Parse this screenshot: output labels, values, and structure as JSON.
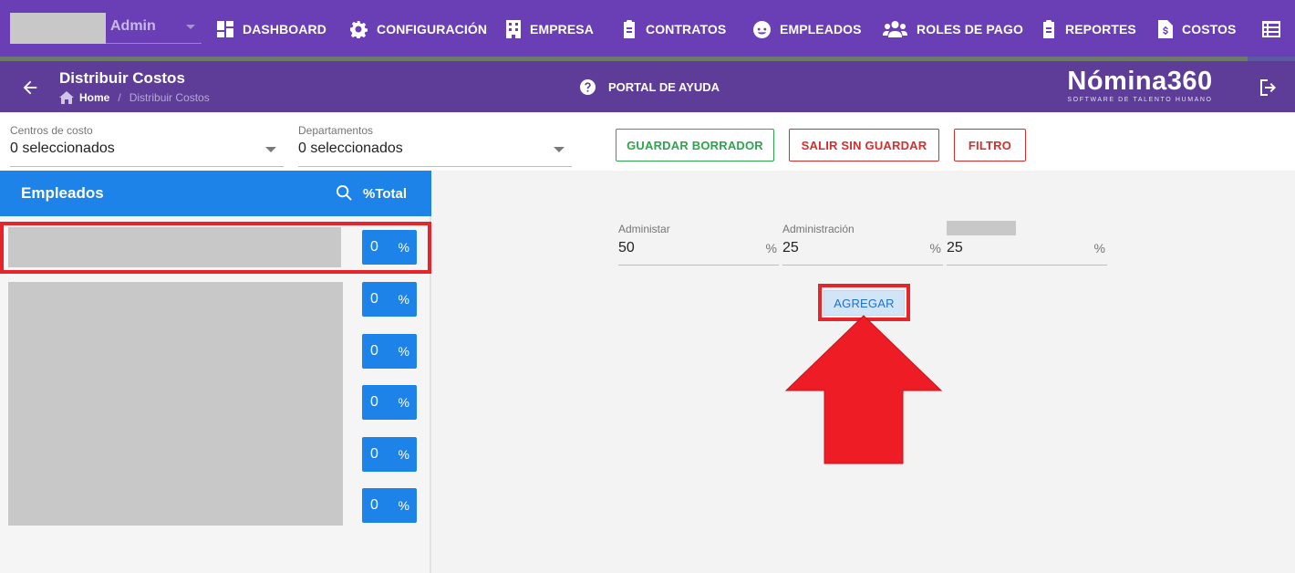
{
  "user": {
    "role": "Admin"
  },
  "nav": [
    {
      "label": "DASHBOARD",
      "icon": "dashboard-icon"
    },
    {
      "label": "CONFIGURACIÓN",
      "icon": "gear-icon"
    },
    {
      "label": "EMPRESA",
      "icon": "building-icon"
    },
    {
      "label": "CONTRATOS",
      "icon": "clipboard-icon"
    },
    {
      "label": "EMPLEADOS",
      "icon": "face-icon"
    },
    {
      "label": "ROLES DE PAGO",
      "icon": "people-icon"
    },
    {
      "label": "REPORTES",
      "icon": "clipboard-icon"
    },
    {
      "label": "COSTOS",
      "icon": "invoice-icon"
    },
    {
      "label": "",
      "icon": "list-icon"
    }
  ],
  "header": {
    "title": "Distribuir Costos",
    "breadcrumb_home": "Home",
    "breadcrumb_sep": "/",
    "breadcrumb_current": "Distribuir Costos",
    "help": "PORTAL DE AYUDA",
    "logo_brand": "Nómina360",
    "logo_tagline": "SOFTWARE DE TALENTO HUMANO"
  },
  "filters": {
    "centros": {
      "label": "Centros de costo",
      "value": "0 seleccionados"
    },
    "departamentos": {
      "label": "Departamentos",
      "value": "0 seleccionados"
    }
  },
  "actions": {
    "guardar": "GUARDAR BORRADOR",
    "salir": "SALIR SIN GUARDAR",
    "filtro": "FILTRO"
  },
  "employees_panel": {
    "title": "Empleados",
    "total_label": "%Total",
    "rows": [
      {
        "value": "0",
        "unit": "%"
      },
      {
        "value": "0",
        "unit": "%"
      },
      {
        "value": "0",
        "unit": "%"
      },
      {
        "value": "0",
        "unit": "%"
      },
      {
        "value": "0",
        "unit": "%"
      },
      {
        "value": "0",
        "unit": "%"
      }
    ]
  },
  "distribution": {
    "fields": [
      {
        "label": "Administar",
        "value": "50",
        "unit": "%"
      },
      {
        "label": "Administración",
        "value": "25",
        "unit": "%"
      },
      {
        "label": "",
        "value": "25",
        "unit": "%"
      }
    ],
    "add_button": "AGREGAR"
  },
  "colors": {
    "nav_bg": "#6a3fb5",
    "subheader_bg": "#5d3d98",
    "primary_blue": "#1e83e8",
    "highlight_red": "#e5252a",
    "save_green": "#2ea44f",
    "exit_red": "#d32f2f"
  }
}
